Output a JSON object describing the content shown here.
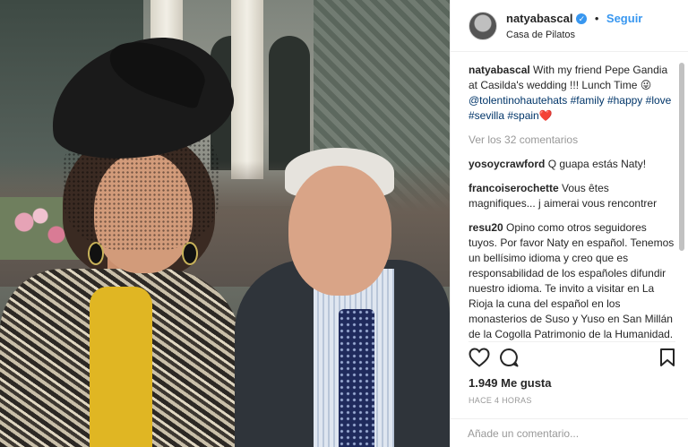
{
  "post": {
    "username": "natyabascal",
    "verified_label": "✓",
    "follow_label": "Seguir",
    "location": "Casa de Pilatos",
    "caption": {
      "username": "natyabascal",
      "text": " With my friend Pepe Gandia at Casilda's wedding !!! Lunch Time 😜",
      "tags": "@tolentinohautehats #family #happy #love #sevilla #spain❤️"
    },
    "view_comments": "Ver los 32 comentarios",
    "comments": [
      {
        "user": "yosoycrawford",
        "text": " Q guapa estás Naty!"
      },
      {
        "user": "francoiserochette",
        "text": " Vous êtes magnifiques... j aimerai vous rencontrer"
      },
      {
        "user": "resu20",
        "text": " Opino como otros seguidores tuyos. Por favor Naty en español. Tenemos un bellísimo idioma y creo que es responsabilidad de los españoles difundir nuestro idioma. Te invito a visitar en La Rioja la cuna del español en los monasterios de Suso y Yuso en San Millán de la Cogolla Patrimonio de la Humanidad. La reina viene todos los años desde qe era princesa. Feliz finde!! 👏"
      }
    ],
    "likes": "1.949 Me gusta",
    "timestamp": "HACE 4 HORAS",
    "comment_placeholder": "Añade un comentario..."
  },
  "icons": {
    "like": "heart-outline-icon",
    "comment": "comment-bubble-icon",
    "save": "bookmark-icon"
  }
}
